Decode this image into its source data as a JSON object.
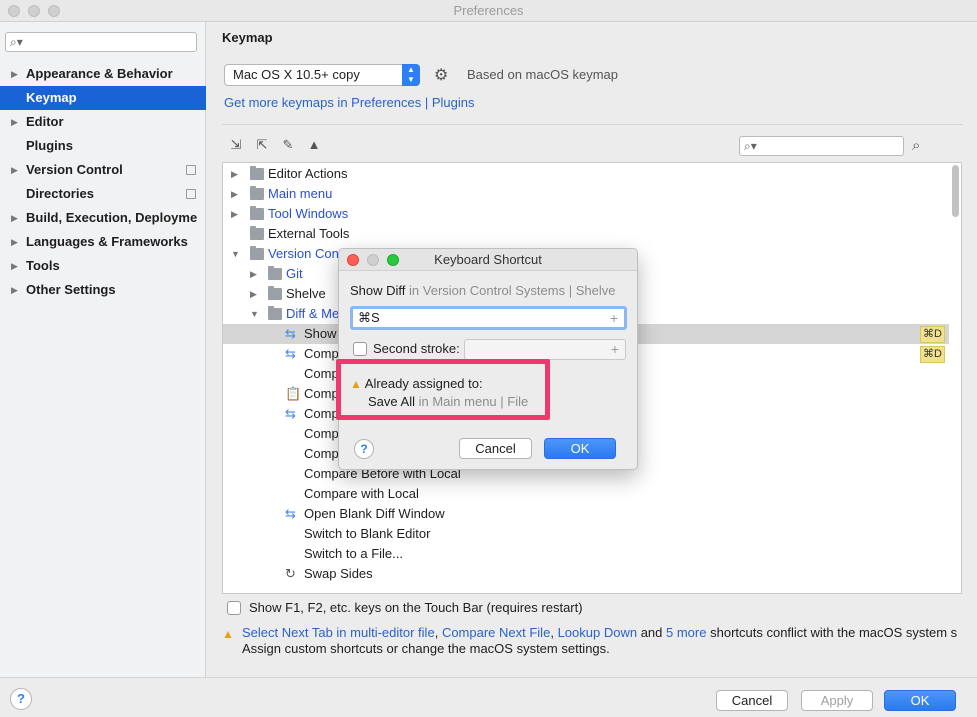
{
  "window": {
    "title": "Preferences"
  },
  "sidebar": {
    "search_placeholder": "",
    "items": [
      {
        "label": "Appearance & Behavior",
        "expandable": true
      },
      {
        "label": "Keymap",
        "selected": true
      },
      {
        "label": "Editor",
        "expandable": true
      },
      {
        "label": "Plugins"
      },
      {
        "label": "Version Control",
        "expandable": true,
        "project_icon": true
      },
      {
        "label": "Directories",
        "project_icon": true
      },
      {
        "label": "Build, Execution, Deployme",
        "expandable": true
      },
      {
        "label": "Languages & Frameworks",
        "expandable": true
      },
      {
        "label": "Tools",
        "expandable": true
      },
      {
        "label": "Other Settings",
        "expandable": true
      }
    ]
  },
  "main": {
    "title": "Keymap",
    "keymap_select_value": "Mac OS X 10.5+ copy",
    "based_on": "Based on macOS keymap",
    "get_more": "Get more keymaps in Preferences | Plugins",
    "tree": {
      "rows": [
        {
          "label": "Editor Actions",
          "type": "editor-actions"
        },
        {
          "label": "Main menu",
          "type": "folder",
          "blue": true
        },
        {
          "label": "Tool Windows",
          "type": "folder",
          "blue": true
        },
        {
          "label": "External Tools",
          "type": "folder"
        },
        {
          "label": "Version Cont",
          "type": "folder",
          "blue": true
        },
        {
          "label": "Git",
          "type": "folder",
          "blue": true
        },
        {
          "label": "Shelve",
          "type": "folder"
        },
        {
          "label": "Diff & Me",
          "type": "folder",
          "blue": true
        },
        {
          "label": "Show",
          "type": "action",
          "shortcut": "⌘D",
          "selected": true
        },
        {
          "label": "Comp",
          "type": "action",
          "shortcut": "⌘D"
        },
        {
          "label": "Comp",
          "type": "plain"
        },
        {
          "label": "Comp",
          "type": "clipboard"
        },
        {
          "label": "Comp",
          "type": "action"
        },
        {
          "label": "Comp",
          "type": "plain"
        },
        {
          "label": "Comp",
          "type": "plain"
        },
        {
          "label": "Compare Before with Local",
          "type": "plain"
        },
        {
          "label": "Compare with Local",
          "type": "plain"
        },
        {
          "label": "Open Blank Diff Window",
          "type": "action"
        },
        {
          "label": "Switch to Blank Editor",
          "type": "plain"
        },
        {
          "label": "Switch to a File...",
          "type": "plain"
        },
        {
          "label": "Swap Sides",
          "type": "swap"
        }
      ]
    },
    "touchbar_label": "Show F1, F2, etc. keys on the Touch Bar (requires restart)",
    "conflict": {
      "links": [
        "Select Next Tab in multi-editor file",
        "Compare Next File",
        "Lookup Down",
        "5 more"
      ],
      "and": "and",
      "sep": ",",
      "tail": "shortcuts conflict with the macOS system s",
      "line2": "Assign custom shortcuts or change the macOS system settings."
    }
  },
  "bottom": {
    "help": "?",
    "cancel": "Cancel",
    "apply": "Apply",
    "ok": "OK"
  },
  "dialog": {
    "title": "Keyboard Shortcut",
    "action_name": "Show Diff",
    "action_path": "in Version Control Systems | Shelve",
    "first_stroke": "⌘S",
    "second_stroke_label": "Second stroke:",
    "assigned_title": "Already assigned to:",
    "assigned_action": "Save All",
    "assigned_path": "in Main menu | File",
    "help": "?",
    "cancel": "Cancel",
    "ok": "OK"
  },
  "colors": {
    "accent": "#1a63d6",
    "link": "#2a63c8",
    "highlight_box": "#f0386e",
    "shortcut_badge": "#f1e28a"
  }
}
